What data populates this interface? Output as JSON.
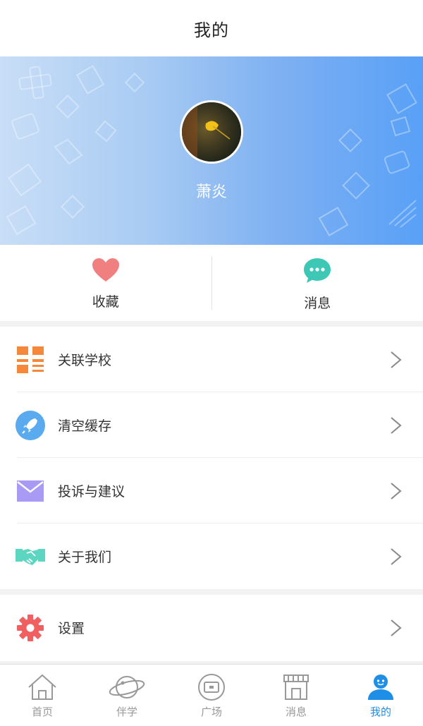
{
  "header": {
    "title": "我的"
  },
  "profile": {
    "username": "萧炎"
  },
  "quick_actions": [
    {
      "label": "收藏",
      "icon": "heart-icon",
      "color": "#f08080"
    },
    {
      "label": "消息",
      "icon": "chat-bubble-icon",
      "color": "#3cc8b4"
    }
  ],
  "menu": [
    {
      "label": "关联学校",
      "icon": "grid-link-icon",
      "color": "#f5883a"
    },
    {
      "label": "清空缓存",
      "icon": "rocket-icon",
      "color": "#5aaaf0"
    },
    {
      "label": "投诉与建议",
      "icon": "envelope-icon",
      "color": "#a99af5"
    },
    {
      "label": "关于我们",
      "icon": "handshake-icon",
      "color": "#5cd6c0"
    }
  ],
  "settings": {
    "label": "设置",
    "icon": "gear-icon",
    "color": "#f06060"
  },
  "tabbar": {
    "active_color": "#1e8ee6",
    "items": [
      {
        "label": "首页",
        "icon": "home-icon"
      },
      {
        "label": "伴学",
        "icon": "planet-icon"
      },
      {
        "label": "广场",
        "icon": "square-tv-icon"
      },
      {
        "label": "消息",
        "icon": "store-icon"
      },
      {
        "label": "我的",
        "icon": "person-icon",
        "active": true
      }
    ]
  }
}
